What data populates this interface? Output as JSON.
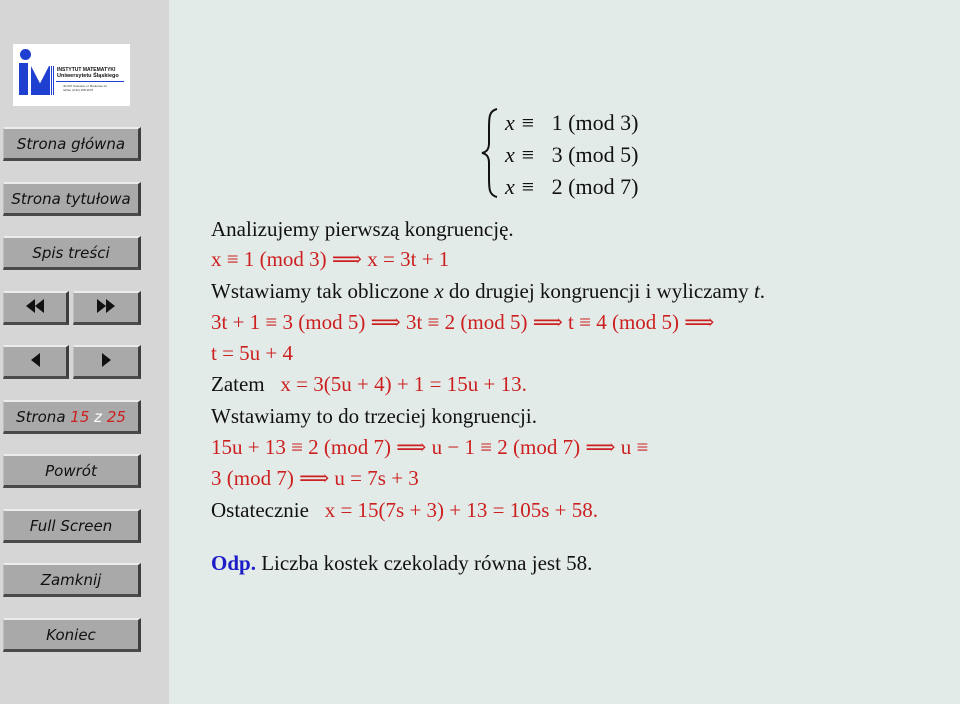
{
  "logo": {
    "line1": "INSTYTUT MATEMATYKI",
    "line2": "Uniwersytetu Śląskiego",
    "line3": "40-007 Katowice ul. Bankowa 14",
    "line4": "tel/fax (0-32) 258 2976"
  },
  "sidebar": {
    "home": "Strona główna",
    "title_page": "Strona tytułowa",
    "toc": "Spis treści",
    "page_label": "Strona",
    "page_current": "15",
    "page_sep": "z",
    "page_total": "25",
    "back": "Powrót",
    "full_screen": "Full Screen",
    "close": "Zamknij",
    "quit": "Koniec"
  },
  "icons": {
    "first": "double-left-triangle",
    "last": "double-right-triangle",
    "prev": "left-triangle",
    "next": "right-triangle"
  },
  "colors": {
    "math": "#cc2020",
    "answer": "#1d1dc8",
    "sidebar": "#d6d6d6",
    "button": "#a9a9a9",
    "page": "#e3ebe9"
  },
  "system": [
    {
      "lhs": "x ≡",
      "rhs": "1 (mod 3)"
    },
    {
      "lhs": "x ≡",
      "rhs": "3 (mod 5)"
    },
    {
      "lhs": "x ≡",
      "rhs": "2 (mod 7)"
    }
  ],
  "content": {
    "l1": "Analizujemy pierwszą kongruencję.",
    "l2": "x ≡ 1 (mod 3)  ⟹  x = 3t + 1",
    "l3a": "Wstawiamy tak obliczone ",
    "l3x": "x",
    "l3b": " do drugiej kongruencji i wyliczamy ",
    "l3t": "t",
    "l3c": ".",
    "l4": "3t + 1 ≡ 3 (mod 5)  ⟹  3t ≡ 2 (mod 5)  ⟹  t ≡ 4 (mod 5)  ⟹",
    "l5": "t = 5u + 4",
    "l6a": "Zatem",
    "l6b": "x = 3(5u + 4) + 1 = 15u + 13.",
    "l7": "Wstawiamy to do trzeciej kongruencji.",
    "l8": "15u + 13  ≡  2  (mod  7)   ⟹   u − 1  ≡  2  (mod  7)   ⟹   u  ≡",
    "l9": "3 (mod 7)  ⟹  u = 7s + 3",
    "l10a": "Ostatecznie",
    "l10b": "x = 15(7s + 3) + 13 = 105s + 58.",
    "ans_label": "Odp.",
    "ans_text": " Liczba kostek czekolady równa jest 58."
  }
}
